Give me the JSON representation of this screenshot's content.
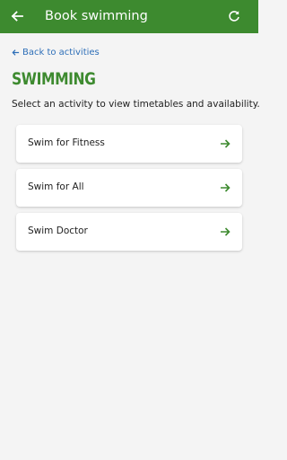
{
  "appbar": {
    "title": "Book swimming",
    "back_icon": "arrow-left-icon",
    "refresh_icon": "refresh-icon",
    "background_color": "#3d8a2f"
  },
  "back_link": {
    "label": "Back to activities",
    "color": "#2e6fb8"
  },
  "page": {
    "heading": "SWIMMING",
    "intro": "Select an activity to view timetables and availability."
  },
  "activities": [
    {
      "label": "Swim for Fitness",
      "icon": "arrow-right-icon"
    },
    {
      "label": "Swim for All",
      "icon": "arrow-right-icon"
    },
    {
      "label": "Swim Doctor",
      "icon": "arrow-right-icon"
    }
  ]
}
